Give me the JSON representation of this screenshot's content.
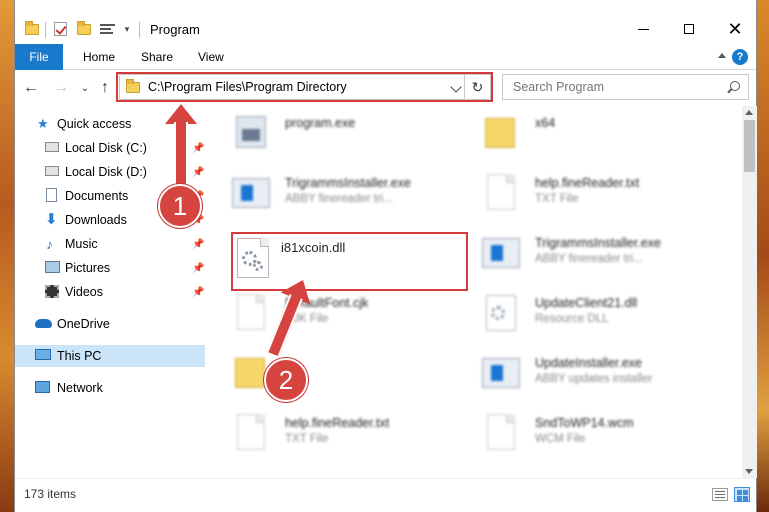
{
  "window": {
    "title": "Program",
    "minimize_label": "Minimize",
    "maximize_label": "Maximize",
    "close_label": "Close"
  },
  "ribbon": {
    "tabs": [
      {
        "label": "File"
      },
      {
        "label": "Home"
      },
      {
        "label": "Share"
      },
      {
        "label": "View"
      }
    ],
    "help_label": "?"
  },
  "navbar": {
    "address": "C:\\Program Files\\Program Directory",
    "search_placeholder": "Search Program"
  },
  "navpane": {
    "items": [
      {
        "label": "Quick access",
        "icon": "star-icon",
        "pinned": false
      },
      {
        "label": "Local Disk (C:)",
        "icon": "drive-icon",
        "pinned": true
      },
      {
        "label": "Local Disk (D:)",
        "icon": "drive-icon",
        "pinned": true
      },
      {
        "label": "Documents",
        "icon": "documents-icon",
        "pinned": true
      },
      {
        "label": "Downloads",
        "icon": "download-icon",
        "pinned": true
      },
      {
        "label": "Music",
        "icon": "music-icon",
        "pinned": true
      },
      {
        "label": "Pictures",
        "icon": "pictures-icon",
        "pinned": true
      },
      {
        "label": "Videos",
        "icon": "videos-icon",
        "pinned": true
      },
      {
        "label": "OneDrive",
        "icon": "cloud-icon",
        "pinned": false
      },
      {
        "label": "This PC",
        "icon": "computer-icon",
        "pinned": false,
        "selected": true
      },
      {
        "label": "Network",
        "icon": "network-icon",
        "pinned": false
      }
    ]
  },
  "files": {
    "left": [
      {
        "name": "program.exe",
        "sub": "",
        "icon": "exe-icon"
      },
      {
        "name": "TrigrammsInstaller.exe",
        "sub": "ABBY finereader tri...",
        "icon": "installer-icon"
      },
      {
        "name": "i81xcoin.dll",
        "sub": "",
        "icon": "dll-icon",
        "highlighted": true
      },
      {
        "name": "DefaultFont.cjk",
        "sub": "CJK File",
        "icon": "doc-icon"
      },
      {
        "name": "",
        "sub": "",
        "icon": "folder-icon"
      },
      {
        "name": "help.fineReader.txt",
        "sub": "TXT File",
        "icon": "doc-icon"
      }
    ],
    "right": [
      {
        "name": "x64",
        "sub": "",
        "icon": "folder-icon"
      },
      {
        "name": "help.fineReader.txt",
        "sub": "TXT File",
        "icon": "doc-icon"
      },
      {
        "name": "TrigrammsInstaller.exe",
        "sub": "ABBY finereader tri...",
        "icon": "installer-icon"
      },
      {
        "name": "UpdateClient21.dll",
        "sub": "Resource DLL",
        "icon": "dll-icon"
      },
      {
        "name": "UpdateInstaller.exe",
        "sub": "ABBY updates installer",
        "icon": "installer-icon"
      },
      {
        "name": "SndToWP14.wcm",
        "sub": "WCM File",
        "icon": "doc-icon"
      }
    ]
  },
  "status": {
    "item_count": "173 items"
  },
  "callouts": [
    "1",
    "2"
  ],
  "colors": {
    "accent": "#1979ca",
    "highlight": "#d43a3a",
    "selected_bg": "#cce4f7"
  }
}
